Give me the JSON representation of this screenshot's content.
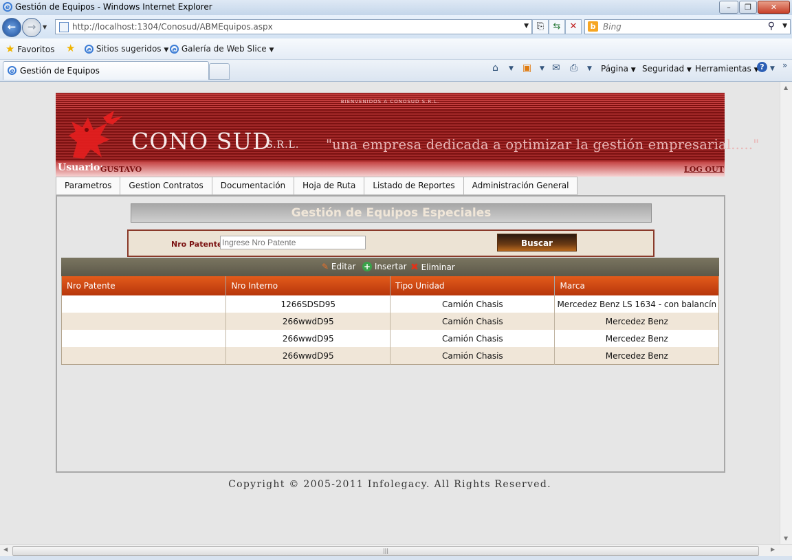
{
  "window": {
    "title": "Gestión de Equipos - Windows Internet Explorer"
  },
  "address": {
    "url": "http://localhost:1304/Conosud/ABMEquipos.aspx"
  },
  "search": {
    "placeholder": "Bing"
  },
  "favorites": {
    "label": "Favoritos",
    "items": [
      "Sitios sugeridos",
      "Galería de Web Slice"
    ]
  },
  "tab": {
    "title": "Gestión de Equipos"
  },
  "commands": [
    "Página",
    "Seguridad",
    "Herramientas"
  ],
  "header": {
    "welcome": "BIENVENIDOS A CONOSUD S.R.L.",
    "company": "CONO SUD",
    "suffix": "S.R.L.",
    "slogan": "\"una empresa dedicada a optimizar la gestión empresarial.....\"",
    "user_label": "Usuario:",
    "user_name": "GUSTAVO",
    "logout": "LOG OUT"
  },
  "menu": [
    "Parametros",
    "Gestion Contratos",
    "Documentación",
    "Hoja de Ruta",
    "Listado de Reportes",
    "Administración General"
  ],
  "page": {
    "title": "Gestión de Equipos Especiales",
    "search_label": "Nro Patente:",
    "search_placeholder": "Ingrese Nro Patente",
    "search_button": "Buscar"
  },
  "grid": {
    "actions": [
      "Editar",
      "Insertar",
      "Eliminar"
    ],
    "columns": [
      "Nro Patente",
      "Nro Interno",
      "Tipo Unidad",
      "Marca"
    ],
    "rows": [
      [
        "",
        "1266SDSD95",
        "Camión Chasis",
        "Mercedez Benz LS 1634 - con balancín"
      ],
      [
        "",
        "266wwdD95",
        "Camión Chasis",
        "Mercedez Benz"
      ],
      [
        "",
        "266wwdD95",
        "Camión Chasis",
        "Mercedez Benz"
      ],
      [
        "",
        "266wwdD95",
        "Camión Chasis",
        "Mercedez Benz"
      ]
    ]
  },
  "footer": {
    "copyright": "Copyright © 2005-2011 Infolegacy. All Rights Reserved."
  },
  "colors": {
    "brand_red": "#8e1616",
    "grid_header": "#d2460f",
    "toolbar": "#6a6653"
  }
}
